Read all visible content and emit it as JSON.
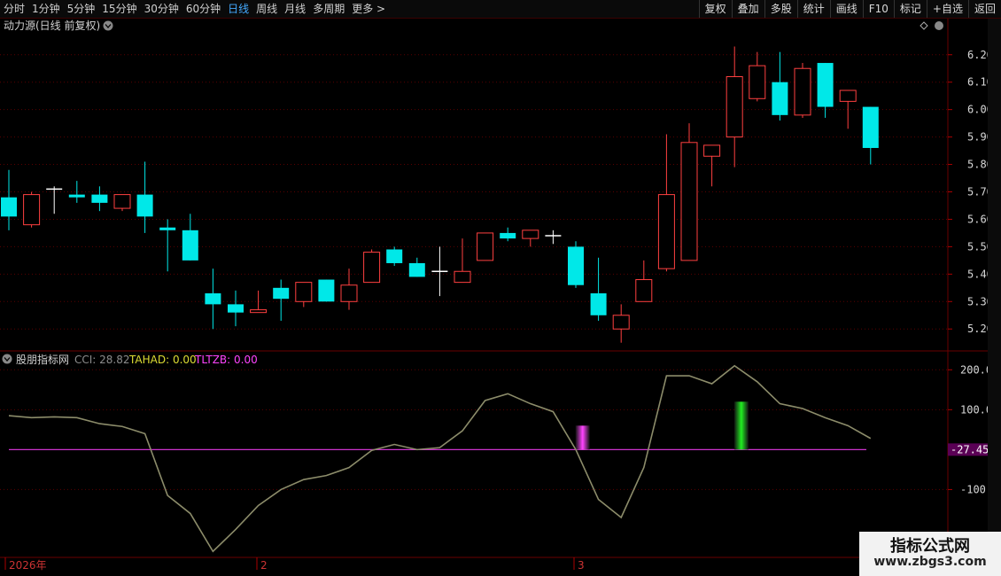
{
  "toolbar": {
    "periods": [
      {
        "label": "分时",
        "active": false
      },
      {
        "label": "1分钟",
        "active": false
      },
      {
        "label": "5分钟",
        "active": false
      },
      {
        "label": "15分钟",
        "active": false
      },
      {
        "label": "30分钟",
        "active": false
      },
      {
        "label": "60分钟",
        "active": false
      },
      {
        "label": "日线",
        "active": true
      },
      {
        "label": "周线",
        "active": false
      },
      {
        "label": "月线",
        "active": false
      },
      {
        "label": "多周期",
        "active": false
      },
      {
        "label": "更多 >",
        "active": false
      }
    ],
    "actions": [
      "复权",
      "叠加",
      "多股",
      "统计",
      "画线",
      "F10",
      "标记",
      "+自选",
      "返回"
    ]
  },
  "main_panel": {
    "title": "动力源(日线 前复权)",
    "price_ticks": [
      "6.20",
      "6.10",
      "6.00",
      "5.90",
      "5.80",
      "5.70",
      "5.60",
      "5.50",
      "5.40",
      "5.30",
      "5.20"
    ]
  },
  "indicator_panel": {
    "name": "股朋指标网",
    "cci_label": "CCI: 28.82",
    "tahad_label": "TAHAD: 0.00",
    "tltzb_label": "TLTZB: 0.00",
    "ticks": [
      "200.0",
      "100.0",
      "-100.0"
    ],
    "baseline_value_label": "-27.45"
  },
  "date_axis": {
    "labels": [
      "2026年",
      "2",
      "3"
    ]
  },
  "watermark": {
    "title": "指标公式网",
    "url": "www.zbgs3.com"
  },
  "colors": {
    "up": "#ff4040",
    "down": "#00e8e8",
    "cci_line": "#8c8c6a",
    "baseline": "#cc33cc",
    "grid": "#5a0000",
    "tahad": "#dddd33",
    "tltzb": "#ff44ff",
    "bar_pink": "#ff44ff",
    "bar_green": "#22ee22"
  },
  "chart_data": [
    {
      "type": "candlestick",
      "title": "动力源(日线 前复权)",
      "ylim": [
        5.12,
        6.28
      ],
      "candles": [
        {
          "o": 5.68,
          "c": 5.61,
          "h": 5.78,
          "l": 5.56
        },
        {
          "o": 5.58,
          "c": 5.69,
          "h": 5.7,
          "l": 5.57
        },
        {
          "o": 5.71,
          "c": 5.71,
          "h": 5.72,
          "l": 5.62
        },
        {
          "o": 5.69,
          "c": 5.68,
          "h": 5.74,
          "l": 5.66
        },
        {
          "o": 5.69,
          "c": 5.66,
          "h": 5.72,
          "l": 5.63
        },
        {
          "o": 5.64,
          "c": 5.69,
          "h": 5.69,
          "l": 5.63
        },
        {
          "o": 5.69,
          "c": 5.61,
          "h": 5.81,
          "l": 5.55
        },
        {
          "o": 5.57,
          "c": 5.56,
          "h": 5.6,
          "l": 5.41
        },
        {
          "o": 5.56,
          "c": 5.45,
          "h": 5.62,
          "l": 5.45
        },
        {
          "o": 5.33,
          "c": 5.29,
          "h": 5.42,
          "l": 5.2
        },
        {
          "o": 5.29,
          "c": 5.26,
          "h": 5.34,
          "l": 5.21
        },
        {
          "o": 5.26,
          "c": 5.27,
          "h": 5.34,
          "l": 5.26
        },
        {
          "o": 5.35,
          "c": 5.31,
          "h": 5.38,
          "l": 5.23
        },
        {
          "o": 5.3,
          "c": 5.37,
          "h": 5.37,
          "l": 5.28
        },
        {
          "o": 5.38,
          "c": 5.3,
          "h": 5.38,
          "l": 5.3
        },
        {
          "o": 5.3,
          "c": 5.36,
          "h": 5.42,
          "l": 5.27
        },
        {
          "o": 5.37,
          "c": 5.48,
          "h": 5.49,
          "l": 5.37
        },
        {
          "o": 5.49,
          "c": 5.44,
          "h": 5.5,
          "l": 5.43
        },
        {
          "o": 5.44,
          "c": 5.39,
          "h": 5.46,
          "l": 5.39
        },
        {
          "o": 5.41,
          "c": 5.41,
          "h": 5.5,
          "l": 5.32
        },
        {
          "o": 5.37,
          "c": 5.41,
          "h": 5.53,
          "l": 5.37
        },
        {
          "o": 5.45,
          "c": 5.55,
          "h": 5.55,
          "l": 5.45
        },
        {
          "o": 5.55,
          "c": 5.53,
          "h": 5.57,
          "l": 5.52
        },
        {
          "o": 5.53,
          "c": 5.56,
          "h": 5.56,
          "l": 5.5
        },
        {
          "o": 5.54,
          "c": 5.54,
          "h": 5.56,
          "l": 5.51
        },
        {
          "o": 5.5,
          "c": 5.36,
          "h": 5.52,
          "l": 5.35
        },
        {
          "o": 5.33,
          "c": 5.25,
          "h": 5.46,
          "l": 5.23
        },
        {
          "o": 5.2,
          "c": 5.25,
          "h": 5.29,
          "l": 5.15
        },
        {
          "o": 5.3,
          "c": 5.38,
          "h": 5.45,
          "l": 5.3
        },
        {
          "o": 5.42,
          "c": 5.69,
          "h": 5.91,
          "l": 5.41
        },
        {
          "o": 5.45,
          "c": 5.88,
          "h": 5.95,
          "l": 5.45
        },
        {
          "o": 5.83,
          "c": 5.87,
          "h": 5.87,
          "l": 5.72
        },
        {
          "o": 5.9,
          "c": 6.12,
          "h": 6.23,
          "l": 5.79
        },
        {
          "o": 6.04,
          "c": 6.16,
          "h": 6.21,
          "l": 6.03
        },
        {
          "o": 6.1,
          "c": 5.98,
          "h": 6.21,
          "l": 5.96
        },
        {
          "o": 5.98,
          "c": 6.15,
          "h": 6.17,
          "l": 5.97
        },
        {
          "o": 6.17,
          "c": 6.01,
          "h": 6.17,
          "l": 5.97
        },
        {
          "o": 6.03,
          "c": 6.07,
          "h": 6.07,
          "l": 5.93
        },
        {
          "o": 6.01,
          "c": 5.86,
          "h": 6.01,
          "l": 5.8
        }
      ]
    },
    {
      "type": "line",
      "title": "股朋指标网",
      "ylim": [
        -270,
        245
      ],
      "series": [
        {
          "name": "CCI",
          "values": [
            85,
            80,
            82,
            80,
            65,
            58,
            40,
            -115,
            -160,
            -255,
            -200,
            -140,
            -100,
            -75,
            -65,
            -45,
            -2,
            13,
            0,
            5,
            47,
            123,
            140,
            115,
            95,
            0,
            -125,
            -170,
            -45,
            185,
            185,
            165,
            210,
            170,
            115,
            103,
            80,
            60,
            28
          ]
        }
      ],
      "markers": [
        {
          "name": "TLTZB",
          "index": 25.3,
          "top": 60,
          "bottom": 0
        },
        {
          "name": "TAHAD",
          "index": 32.3,
          "top": 120,
          "bottom": 0
        }
      ],
      "baseline": 0
    }
  ]
}
